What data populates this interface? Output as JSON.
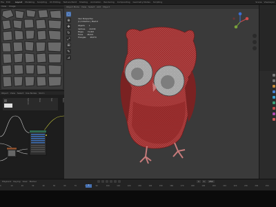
{
  "topbar": {
    "menus": [
      "File",
      "Edit",
      "Render",
      "Window",
      "Help"
    ],
    "workspaces": [
      "Layout",
      "Modeling",
      "Sculpting",
      "UV Editing",
      "Texture Paint",
      "Shading",
      "Animation",
      "Rendering",
      "Compositing",
      "Geometry Nodes",
      "Scripting"
    ],
    "scene": "Scene",
    "view_layer": "ViewLayer"
  },
  "texture_panel": {
    "header": [
      "View",
      "Image",
      "Texture"
    ]
  },
  "node_panel": {
    "header": [
      "Object",
      "View",
      "Select",
      "Add",
      "Node",
      "Use Nodes"
    ],
    "slot": "Slot 1",
    "material": "Material",
    "side_tabs": [
      "Node",
      "Tool",
      "View",
      "Options"
    ],
    "node_title": "Principled BSDF"
  },
  "viewport": {
    "header": [
      "Object Mode",
      "View",
      "Select",
      "Add",
      "Object",
      "Global"
    ],
    "overlay": {
      "title": "User Perspective",
      "collection": "(1) Collection | Mesh.0",
      "stats": [
        {
          "label": "Objects",
          "value": "1"
        },
        {
          "label": "Vertices",
          "value": "24,530"
        },
        {
          "label": "Edges",
          "value": "72,063"
        },
        {
          "label": "Faces",
          "value": "48,021"
        },
        {
          "label": "Triangles",
          "value": "48,074"
        }
      ]
    }
  },
  "timeline": {
    "header": [
      "Playback",
      "Keying",
      "View",
      "Marker"
    ],
    "current_frame": "1",
    "ruler": [
      "0",
      "10",
      "20",
      "30",
      "40",
      "50",
      "60",
      "70",
      "80",
      "90",
      "100",
      "110",
      "120",
      "130",
      "140",
      "150",
      "160",
      "170",
      "180",
      "190",
      "200",
      "210",
      "220",
      "230",
      "240",
      "250"
    ],
    "start": "1",
    "end": "250"
  },
  "colors": {
    "accent": "#4772b3",
    "owl_body": "#a02e2e",
    "viewport_bg": "#3a3a3a"
  }
}
